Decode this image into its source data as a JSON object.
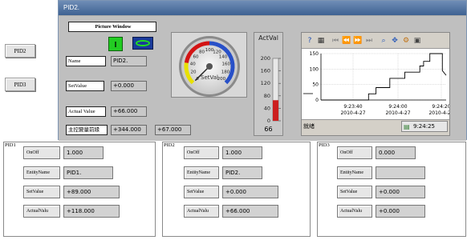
{
  "left_buttons": {
    "pid2": "PID2",
    "pid3": "PID3"
  },
  "window": {
    "title": "PID2.",
    "picture_window_label": "Picture Window",
    "name_label": "Name",
    "name_value": "PID2.",
    "setvalue_label": "SetValue",
    "setvalue_value": "+0.000",
    "actual_label": "Actual Value",
    "actual_value": "+66.000",
    "chinese_label": "主控變量前緣",
    "chinese_value_1": "+344.000",
    "chinese_value_2": "+67.000",
    "gauge": {
      "label": "SetVal",
      "ticks": [
        "0",
        "20",
        "40",
        "60",
        "80",
        "100",
        "120",
        "140",
        "160",
        "180",
        "200"
      ],
      "value": 0
    },
    "actval": {
      "title": "ActVal",
      "ticks": [
        "200",
        "160",
        "120",
        "80",
        "40",
        "0"
      ],
      "readout": "66",
      "level": 66,
      "max": 200
    },
    "trend": {
      "ylabels": [
        "150",
        "100",
        "50",
        "0"
      ],
      "xlabels": [
        {
          "time": "9:23:40",
          "date": "2010-4-27"
        },
        {
          "time": "9:24:00",
          "date": "2010-4-27"
        },
        {
          "time": "9:24:20",
          "date": "2010-4-27"
        }
      ],
      "status_left": "就绪",
      "status_time": "9:24:25"
    }
  },
  "panels": [
    {
      "title": "PID1",
      "onoff_label": "OnOff",
      "onoff_value": "1.000",
      "entity_label": "EntityName",
      "entity_value": "PID1.",
      "setvalue_label": "SetValue",
      "setvalue_value": "+89.000",
      "actual_label": "ActualValu",
      "actual_value": "+118.000"
    },
    {
      "title": "PID2",
      "onoff_label": "OnOff",
      "onoff_value": "1.000",
      "entity_label": "EntityName",
      "entity_value": "PID2.",
      "setvalue_label": "SetValue",
      "setvalue_value": "+0.000",
      "actual_label": "ActualValu",
      "actual_value": "+66.000"
    },
    {
      "title": "PID3",
      "onoff_label": "OnOff",
      "onoff_value": "0.000",
      "entity_label": "EntityName",
      "entity_value": "",
      "setvalue_label": "SetValue",
      "setvalue_value": "+0.000",
      "actual_label": "ActualValu",
      "actual_value": "+0.000"
    }
  ],
  "colors": {
    "title_bar": "#4a6b99",
    "toggle_green": "#22cc22",
    "actval_fill": "#cc1f1f",
    "gauge_red": "#d31414",
    "gauge_blue": "#2850c8",
    "gauge_yellow": "#e8e000"
  }
}
